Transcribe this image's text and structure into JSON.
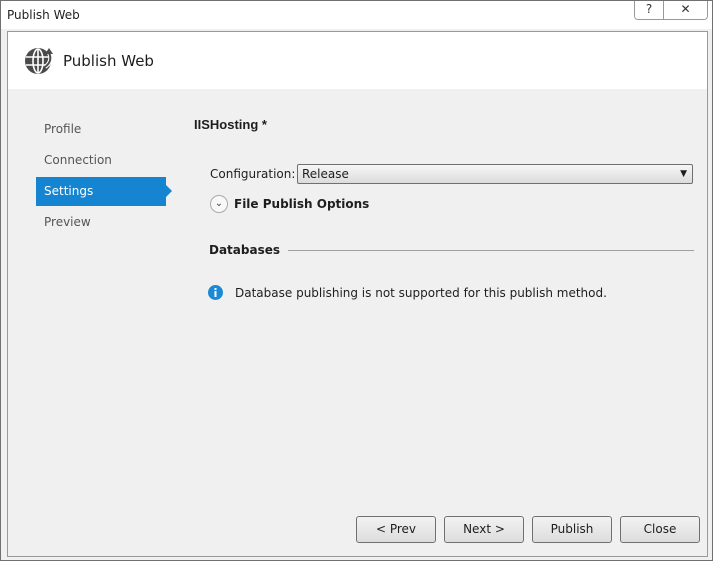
{
  "window": {
    "title": "Publish Web",
    "help_label": "?",
    "close_label": "✕"
  },
  "header": {
    "title": "Publish Web",
    "icon": "globe-publish-icon"
  },
  "nav": {
    "items": [
      {
        "label": "Profile"
      },
      {
        "label": "Connection"
      },
      {
        "label": "Settings",
        "active": true
      },
      {
        "label": "Preview"
      }
    ]
  },
  "settings": {
    "profile_name": "IISHosting *",
    "configuration_label": "Configuration:",
    "configuration_value": "Release",
    "file_publish_options": "File Publish Options",
    "databases_label": "Databases",
    "info_message": "Database publishing is not supported for this publish method."
  },
  "buttons": {
    "prev": "< Prev",
    "next": "Next >",
    "publish": "Publish",
    "close": "Close"
  },
  "colors": {
    "accent": "#1585d2",
    "info": "#1a8ad4"
  }
}
